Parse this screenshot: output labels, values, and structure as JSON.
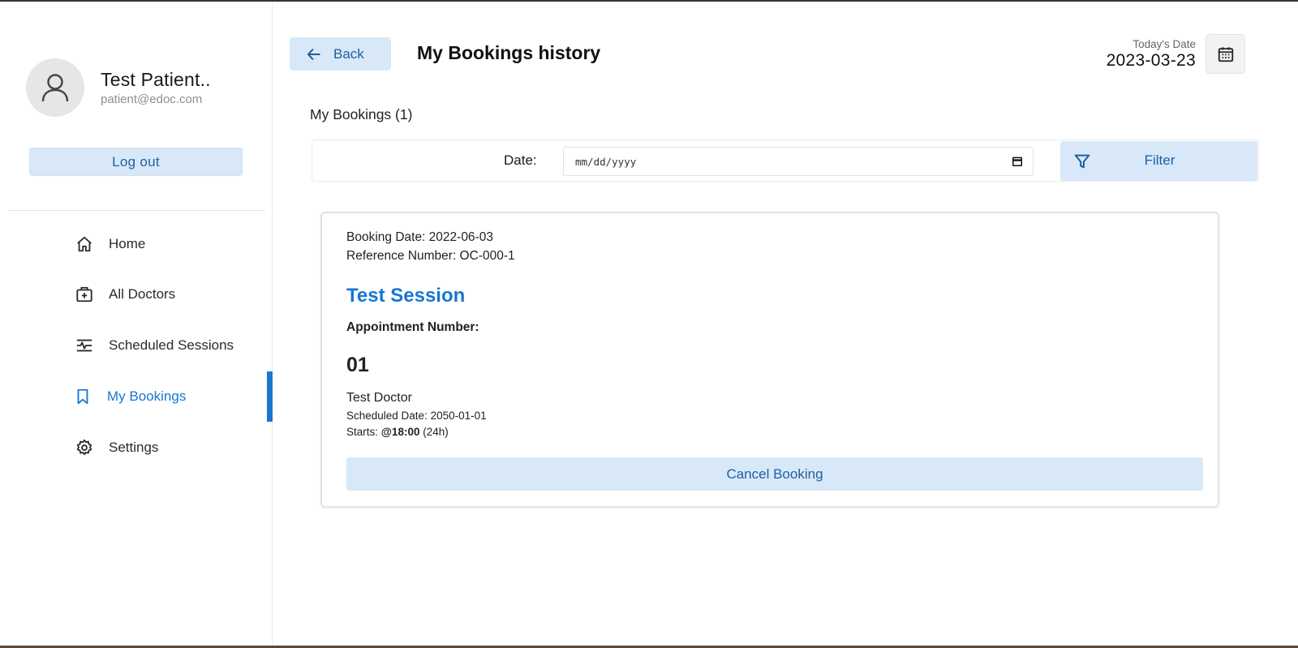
{
  "sidebar": {
    "profile": {
      "name": "Test Patient..",
      "email": "patient@edoc.com"
    },
    "logout_label": "Log out",
    "items": [
      {
        "label": "Home",
        "icon": "home-icon"
      },
      {
        "label": "All Doctors",
        "icon": "medical-bag-icon"
      },
      {
        "label": "Scheduled Sessions",
        "icon": "schedule-chart-icon"
      },
      {
        "label": "My Bookings",
        "icon": "bookmark-icon",
        "active": true
      },
      {
        "label": "Settings",
        "icon": "gear-icon"
      }
    ]
  },
  "header": {
    "back_label": "Back",
    "title": "My Bookings history",
    "today_label": "Today's Date",
    "today_date": "2023-03-23"
  },
  "main": {
    "section_title": "My Bookings (1)",
    "filter": {
      "date_label": "Date:",
      "date_placeholder": "mm/dd/yyyy",
      "button_label": "Filter"
    },
    "booking": {
      "booking_date": "Booking Date: 2022-06-03",
      "reference": "Reference Number: OC-000-1",
      "session_title": "Test Session",
      "appointment_label": "Appointment Number:",
      "appointment_number": "01",
      "doctor": "Test Doctor",
      "scheduled_date": "Scheduled Date: 2050-01-01",
      "starts_prefix": "Starts: ",
      "starts_time": "@18:00",
      "starts_suffix": " (24h)",
      "cancel_label": "Cancel Booking"
    }
  },
  "colors": {
    "accent": "#1877d2",
    "button_bg": "#d8e8f8",
    "button_text": "#1f5f9e"
  }
}
